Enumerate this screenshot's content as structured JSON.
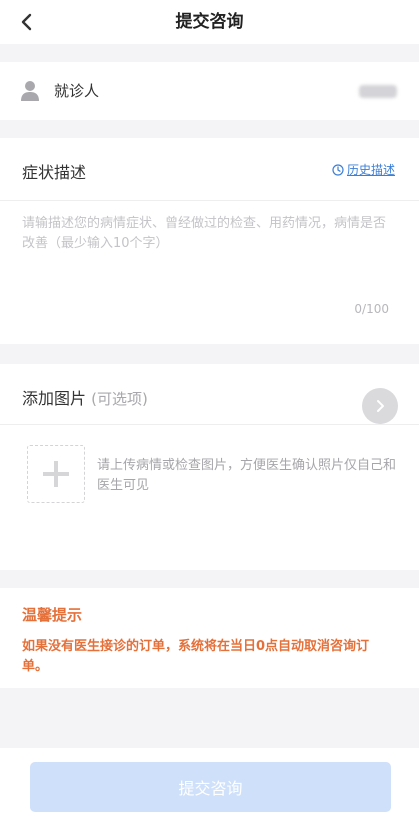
{
  "header": {
    "title": "提交咨询",
    "back_icon": "chevron-left-icon"
  },
  "patient": {
    "label": "就诊人",
    "icon": "person-icon",
    "name_blurred": true
  },
  "symptom": {
    "title": "症状描述",
    "history_label": "历史描述",
    "history_icon": "clock-icon",
    "placeholder": "请输描述您的病情症状、曾经做过的检查、用药情况，病情是否改善（最少输入10个字）",
    "value": "",
    "counter": "0/100"
  },
  "images": {
    "title": "添加图片",
    "optional": "(可选项)",
    "arrow_icon": "chevron-right-icon",
    "add_icon": "plus-icon",
    "hint": "请上传病情或检查图片，方便医生确认照片仅自己和医生可见"
  },
  "tips": {
    "title": "温馨提示",
    "text": "如果没有医生接诊的订单，系统将在当日0点自动取消咨询订单。"
  },
  "submit": {
    "label": "提交咨询",
    "enabled": false
  },
  "colors": {
    "accent": "#3d7fd6",
    "warning": "#e5703a",
    "button_disabled": "#cfe0fb",
    "background": "#f4f4f6"
  }
}
